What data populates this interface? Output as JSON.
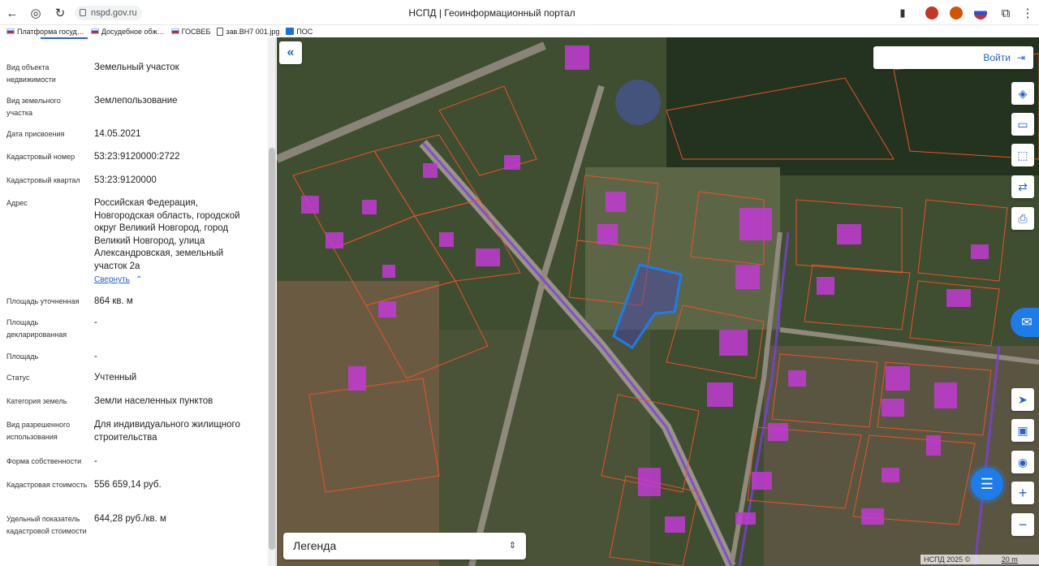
{
  "browser": {
    "url": "nspd.gov.ru",
    "title": "НСПД | Геоинформационный портал"
  },
  "bookmarks": [
    "Платформа госуд…",
    "Досудебное обж…",
    "ГОСВЕБ",
    "зав.ВН7 001.jpg",
    "ПОС"
  ],
  "info": {
    "rows": [
      {
        "label": "Вид объекта недвижимости",
        "value": "Земельный участок"
      },
      {
        "label": "Вид земельного участка",
        "value": "Землепользование"
      },
      {
        "label": "Дата присвоения",
        "value": "14.05.2021"
      },
      {
        "label": "Кадастровый номер",
        "value": "53:23:9120000:2722"
      },
      {
        "label": "Кадастровый квартал",
        "value": "53:23:9120000"
      },
      {
        "label": "Адрес",
        "value": "Российская Федерация, Новгородская область, городской округ Великий Новгород, город Великий Новгород, улица Александровская, земельный участок 2а"
      },
      {
        "label": "Площадь уточненная",
        "value": "864 кв. м"
      },
      {
        "label": "Площадь декларированная",
        "value": "-"
      },
      {
        "label": "Площадь",
        "value": "-"
      },
      {
        "label": "Статус",
        "value": "Учтенный"
      },
      {
        "label": "Категория земель",
        "value": "Земли населенных пунктов"
      },
      {
        "label": "Вид разрешенного использования",
        "value": "Для индивидуального жилищного строительства"
      },
      {
        "label": "Форма собственности",
        "value": "-"
      },
      {
        "label": "Кадастровая стоимость",
        "value": "556 659,14 руб."
      },
      {
        "label": "Удельный показатель кадастровой стоимости",
        "value": "644,28 руб./кв. м"
      }
    ],
    "collapse_link": "Свернуть"
  },
  "map": {
    "login_label": "Войти",
    "legend_label": "Легенда",
    "attribution": "НСПД 2025 ©",
    "scale_label": "20 m",
    "tools": [
      "layers-icon",
      "ruler-icon",
      "select-area-icon",
      "share-icon",
      "print-icon"
    ],
    "bottom_tools": [
      "locate-icon",
      "minimap-icon",
      "geo-search-icon",
      "zoom-in-icon",
      "zoom-out-icon"
    ],
    "colors": {
      "parcel_border": "#e8532a",
      "building": "#c23bd4",
      "road_zone": "#7b3fe0",
      "selected": "#1e7ce8"
    }
  }
}
